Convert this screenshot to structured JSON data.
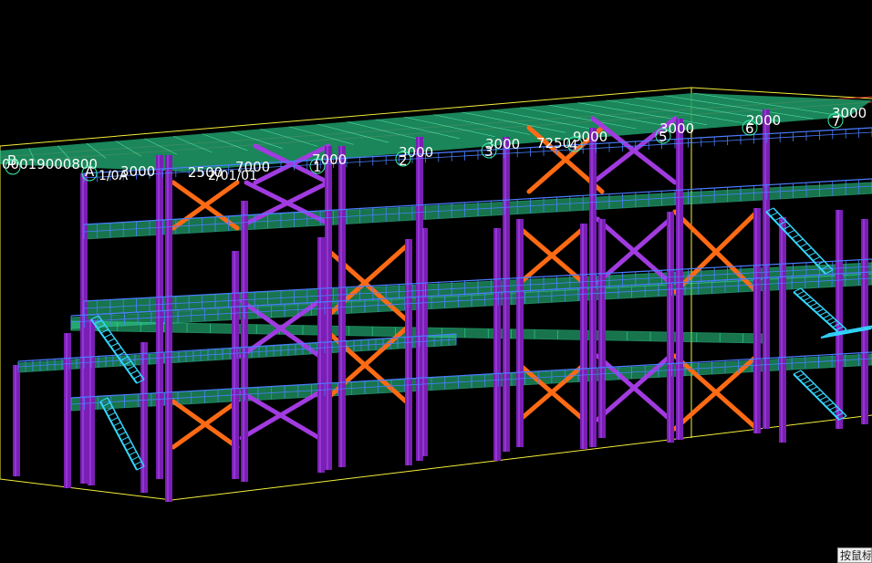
{
  "viewport": {
    "background": "#000000",
    "colors": {
      "column": "#7a1fb3",
      "column_light": "#9b3fe0",
      "brace_orange": "#ff6a14",
      "brace_purple": "#a13be0",
      "beam_green": "#3af0a8",
      "slab_green": "#2bd48a",
      "rail_blue": "#4a7dff",
      "stair_cyan": "#33d6ff",
      "bbox_yellow": "#f5ef3a",
      "axis_red": "#ff3030"
    },
    "dimension_labels": [
      {
        "text": "00019000800"
      },
      {
        "text": "B"
      },
      {
        "text": "A"
      },
      {
        "text": "1/0A"
      },
      {
        "text": "3000"
      },
      {
        "text": "2500"
      },
      {
        "text": "7000"
      },
      {
        "text": "2/01/01"
      },
      {
        "text": "7000"
      },
      {
        "text": "1"
      },
      {
        "text": "3000"
      },
      {
        "text": "2"
      },
      {
        "text": "3000"
      },
      {
        "text": "3"
      },
      {
        "text": "7250"
      },
      {
        "text": "4"
      },
      {
        "text": "9000"
      },
      {
        "text": "3000"
      },
      {
        "text": "5"
      },
      {
        "text": "2000"
      },
      {
        "text": "6"
      },
      {
        "text": "3000"
      },
      {
        "text": "7"
      }
    ]
  },
  "status_tip": {
    "text": "按鼠标"
  }
}
